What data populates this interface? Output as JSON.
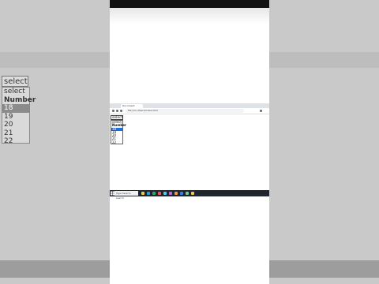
{
  "background": {
    "select_value": "select",
    "options": [
      "select",
      "Number",
      "18",
      "19",
      "20",
      "21",
      "22"
    ]
  },
  "browser": {
    "tab_title": "Document",
    "address": "file:///C:/Users/index.html"
  },
  "dropdown": {
    "value": "select",
    "options": [
      {
        "label": "select",
        "bold": false,
        "highlighted": false
      },
      {
        "label": "Number",
        "bold": true,
        "highlighted": false
      },
      {
        "label": "18",
        "bold": false,
        "highlighted": true
      },
      {
        "label": "19",
        "bold": false,
        "highlighted": false
      },
      {
        "label": "20",
        "bold": false,
        "highlighted": false
      },
      {
        "label": "21",
        "bold": false,
        "highlighted": false
      },
      {
        "label": "22",
        "bold": false,
        "highlighted": false
      }
    ]
  },
  "taskbar": {
    "search_placeholder": "Type here to search",
    "icon_colors": [
      "#f2c94c",
      "#2d9cdb",
      "#27ae60",
      "#eb5757",
      "#56ccf2",
      "#bb6bd9",
      "#f2994a",
      "#2f80ed",
      "#6fcf97",
      "#f2c94c"
    ]
  },
  "colors": {
    "highlight": "#1e6fd9",
    "taskbar": "#1f2630"
  }
}
